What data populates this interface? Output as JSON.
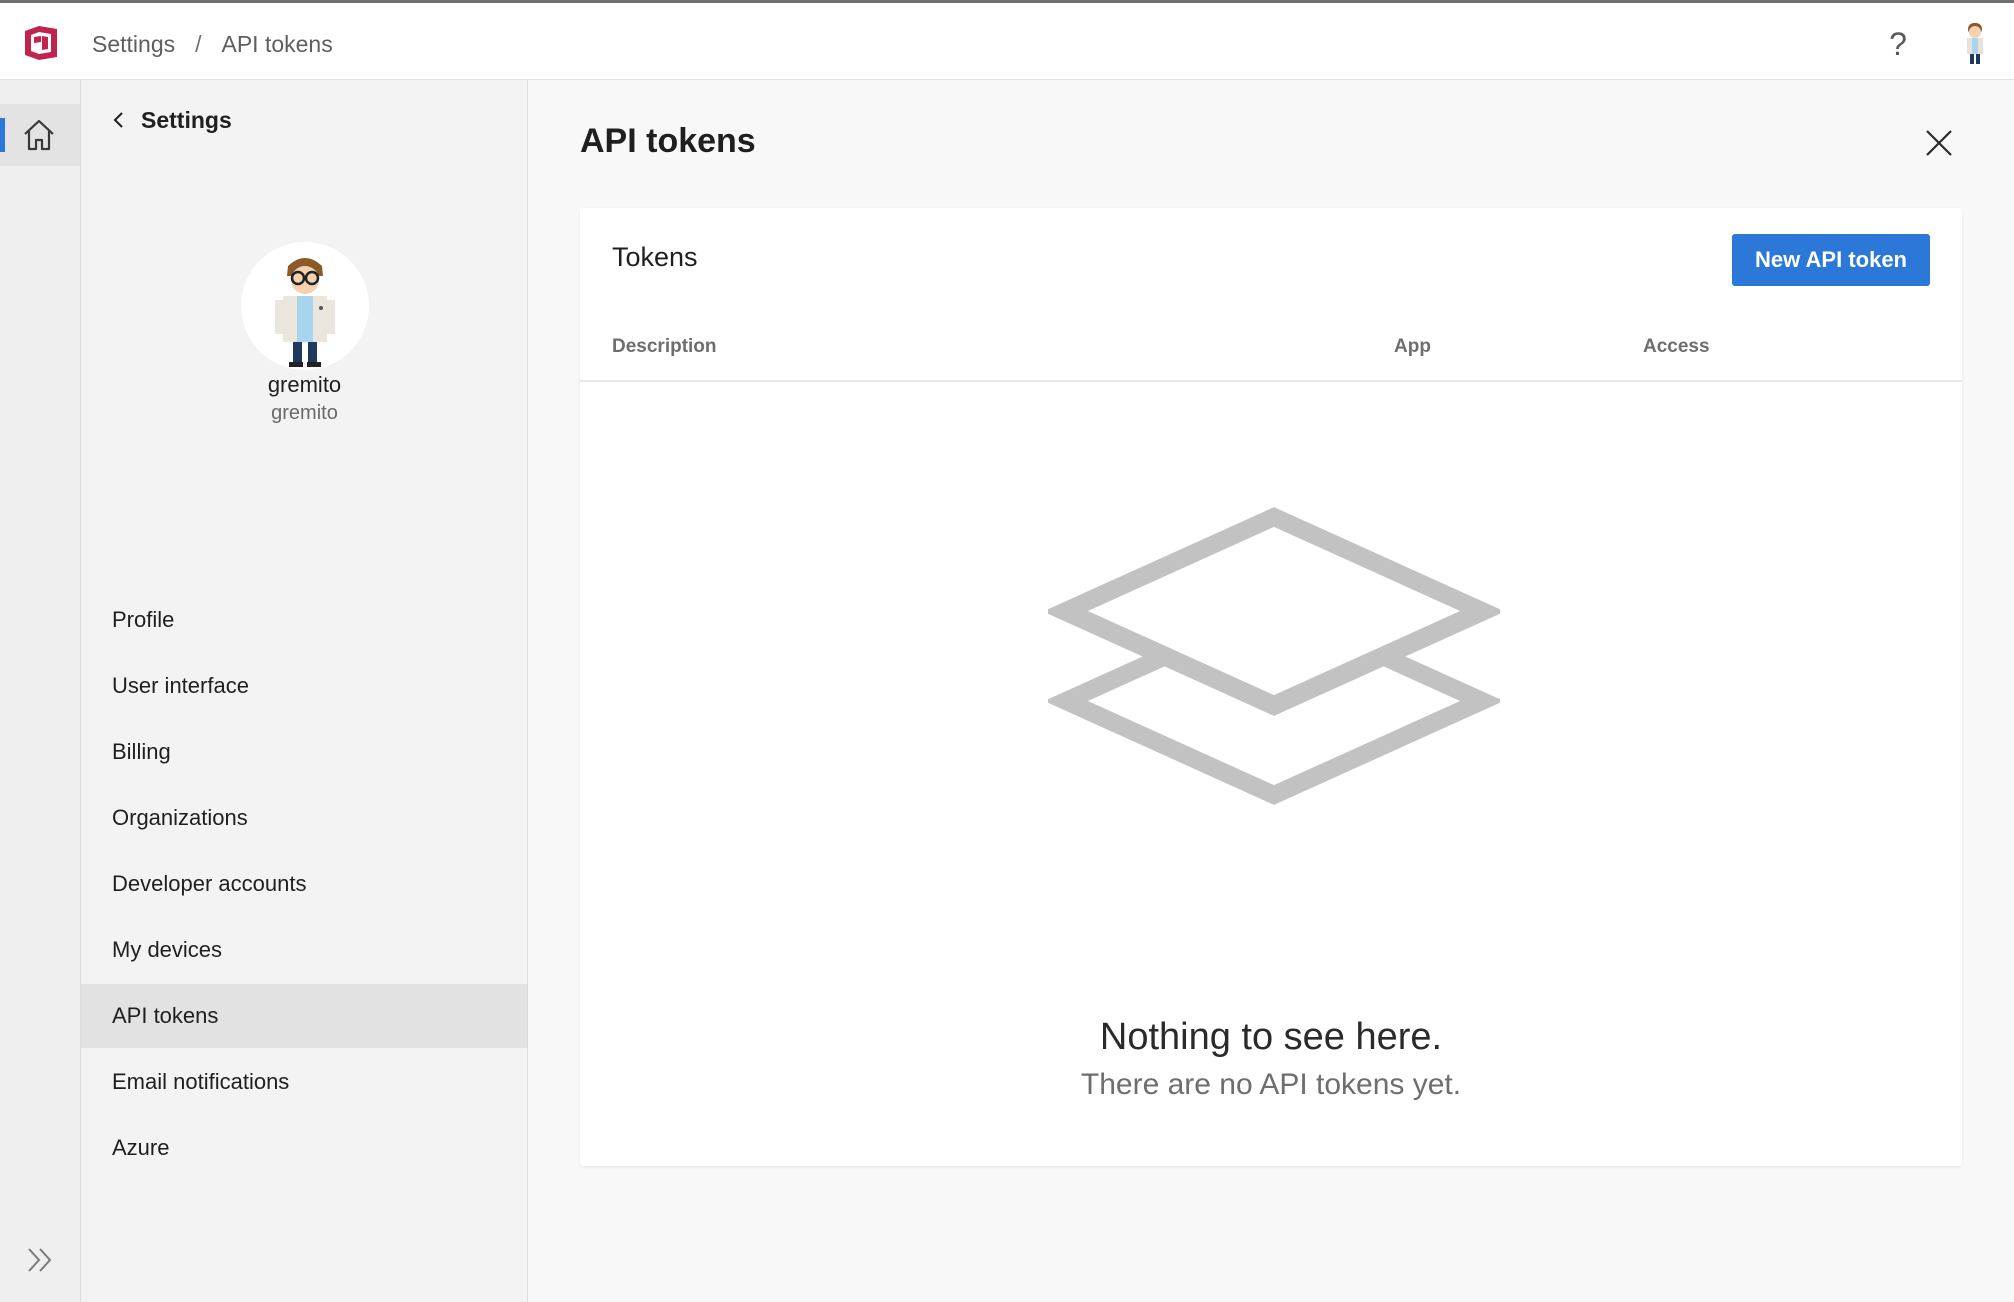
{
  "breadcrumb": {
    "root": "Settings",
    "separator": "/",
    "current": "API tokens"
  },
  "header": {
    "help_icon": "help-icon",
    "avatar": "user-avatar"
  },
  "rail": {
    "home_icon": "home-icon",
    "expand_icon": "double-chevron-right-icon"
  },
  "settings_nav": {
    "back_label": "Settings",
    "user": {
      "display_name": "gremito",
      "username": "gremito"
    },
    "items": [
      {
        "label": "Profile",
        "active": false
      },
      {
        "label": "User interface",
        "active": false
      },
      {
        "label": "Billing",
        "active": false
      },
      {
        "label": "Organizations",
        "active": false
      },
      {
        "label": "Developer accounts",
        "active": false
      },
      {
        "label": "My devices",
        "active": false
      },
      {
        "label": "API tokens",
        "active": true
      },
      {
        "label": "Email notifications",
        "active": false
      },
      {
        "label": "Azure",
        "active": false
      }
    ]
  },
  "main": {
    "title": "API tokens",
    "close_icon": "close-icon",
    "card": {
      "title": "Tokens",
      "new_button_label": "New API token",
      "columns": [
        "Description",
        "App",
        "Access"
      ],
      "rows": [],
      "empty_state": {
        "icon": "stacked-layers-icon",
        "title": "Nothing to see here.",
        "subtitle": "There are no API tokens yet."
      }
    }
  },
  "colors": {
    "accent": "#2b78d8",
    "illustration": "#c2c2c2",
    "active_nav_bg": "#e2e2e2"
  }
}
